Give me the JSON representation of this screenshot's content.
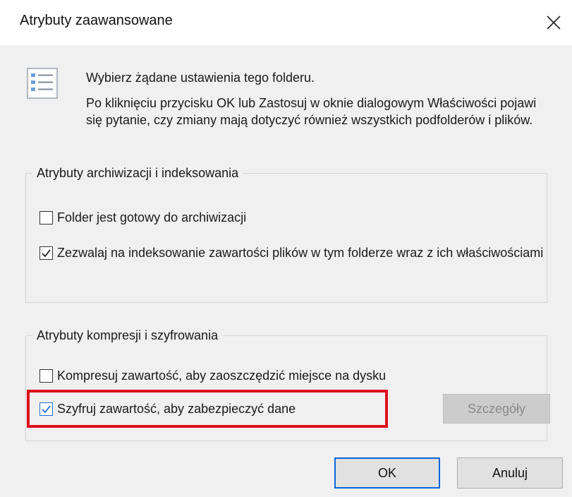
{
  "window": {
    "title": "Atrybuty zaawansowane",
    "close_icon": "close-icon"
  },
  "intro": {
    "icon": "checklist-icon",
    "title": "Wybierz żądane ustawienia tego folderu.",
    "text": "Po kliknięciu przycisku OK lub Zastosuj w oknie dialogowym Właściwości pojawi się pytanie, czy zmiany mają dotyczyć również wszystkich podfolderów i plików."
  },
  "archive_group": {
    "title": "Atrybuty archiwizacji i indeksowania",
    "options": [
      {
        "label": "Folder jest gotowy do archiwizacji",
        "checked": false
      },
      {
        "label": "Zezwalaj na indeksowanie zawartości plików w tym folderze wraz z ich właściwościami",
        "checked": true
      }
    ]
  },
  "compress_group": {
    "title": "Atrybuty kompresji i szyfrowania",
    "options": [
      {
        "label": "Kompresuj zawartość, aby zaoszczędzić miejsce na dysku",
        "checked": false
      },
      {
        "label": "Szyfruj zawartość, aby zabezpieczyć dane",
        "checked": true,
        "highlighted": true
      }
    ],
    "details_button": {
      "label": "Szczegóły",
      "enabled": false
    }
  },
  "buttons": {
    "ok_label": "OK",
    "cancel_label": "Anuluj"
  },
  "colors": {
    "highlight_border": "#e0101c",
    "default_button_border": "#0a64d8",
    "client_background": "#f0f0f0"
  }
}
